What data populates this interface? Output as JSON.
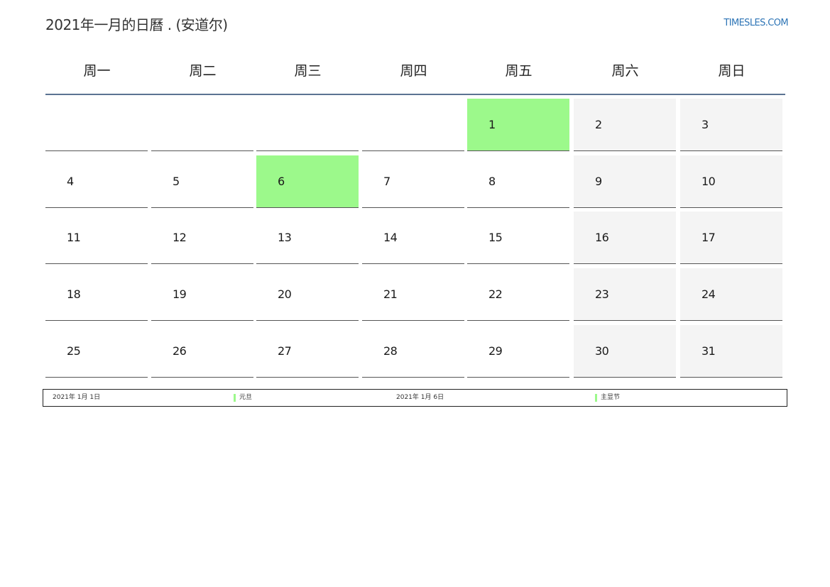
{
  "header": {
    "title": "2021年一月的日曆 . (安道尔)",
    "brand": "TIMESLES.COM"
  },
  "calendar": {
    "weekdays": [
      "周一",
      "周二",
      "周三",
      "周四",
      "周五",
      "周六",
      "周日"
    ],
    "weeks": [
      [
        "",
        "",
        "",
        "",
        "1",
        "2",
        "3"
      ],
      [
        "4",
        "5",
        "6",
        "7",
        "8",
        "9",
        "10"
      ],
      [
        "11",
        "12",
        "13",
        "14",
        "15",
        "16",
        "17"
      ],
      [
        "18",
        "19",
        "20",
        "21",
        "22",
        "23",
        "24"
      ],
      [
        "25",
        "26",
        "27",
        "28",
        "29",
        "30",
        "31"
      ]
    ],
    "holidays": [
      "1",
      "6"
    ]
  },
  "legend": {
    "entries": [
      {
        "date": "2021年 1月 1日",
        "name": "元旦"
      },
      {
        "date": "2021年 1月 6日",
        "name": "主显节"
      }
    ]
  },
  "colors": {
    "holiday": "#9cf98b",
    "weekend": "#f4f4f4",
    "header_rule": "#5b7392",
    "brand": "#2e75b6"
  }
}
